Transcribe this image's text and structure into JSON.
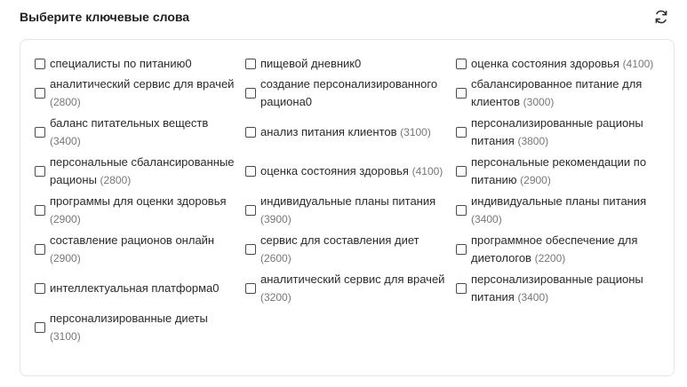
{
  "header": {
    "title": "Выберите ключевые слова",
    "refresh_icon": "refresh-icon"
  },
  "keywords": [
    {
      "label": "специалисты по питанию0",
      "count": ""
    },
    {
      "label": "пищевой дневник0",
      "count": ""
    },
    {
      "label": "оценка состояния здоровья",
      "count": "(4100)"
    },
    {
      "label": "аналитический сервис для врачей",
      "count": "(2800)"
    },
    {
      "label": "создание персонализированного рациона0",
      "count": ""
    },
    {
      "label": "сбалансированное питание для клиентов",
      "count": "(3000)"
    },
    {
      "label": "баланс питательных веществ",
      "count": "(3400)"
    },
    {
      "label": "анализ питания клиентов",
      "count": "(3100)"
    },
    {
      "label": "персонализированные рационы питания",
      "count": "(3800)"
    },
    {
      "label": "персональные сбалансированные рационы",
      "count": "(2800)"
    },
    {
      "label": "оценка состояния здоровья",
      "count": "(4100)"
    },
    {
      "label": "персональные рекомендации по питанию",
      "count": "(2900)"
    },
    {
      "label": "программы для оценки здоровья",
      "count": "(2900)"
    },
    {
      "label": "индивидуальные планы питания",
      "count": "(3900)"
    },
    {
      "label": "индивидуальные планы питания",
      "count": "(3400)"
    },
    {
      "label": "составление рационов онлайн",
      "count": "(2900)"
    },
    {
      "label": "сервис для составления диет",
      "count": "(2600)"
    },
    {
      "label": "программное обеспечение для диетологов",
      "count": "(2200)"
    },
    {
      "label": "интеллектуальная платформа0",
      "count": ""
    },
    {
      "label": "аналитический сервис для врачей",
      "count": "(3200)"
    },
    {
      "label": "персонализированные рационы питания",
      "count": "(3400)"
    },
    {
      "label": "персонализированные диеты",
      "count": "(3100)"
    }
  ]
}
